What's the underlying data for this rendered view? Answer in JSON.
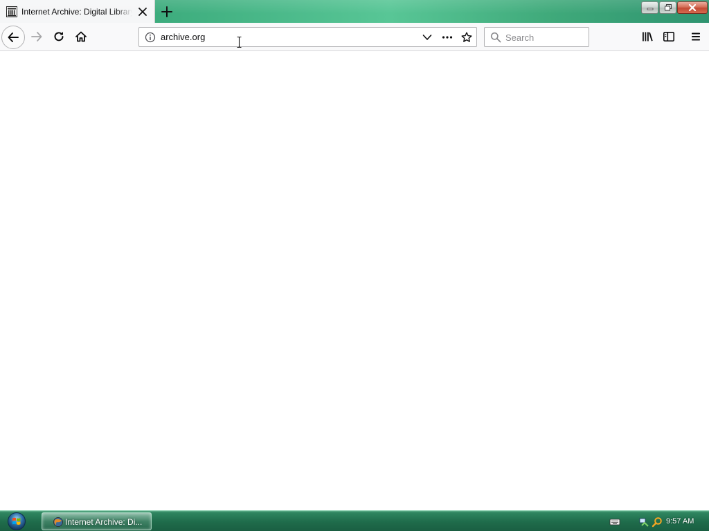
{
  "window": {
    "tab_title": "Internet Archive: Digital Library",
    "tab_favicon": "archive-building-icon"
  },
  "toolbar": {
    "url": "archive.org",
    "search_placeholder": "Search"
  },
  "taskbar": {
    "task_label": "Internet Archive: Di...",
    "clock": "9:57 AM"
  },
  "colors": {
    "accent": "#3fae7f",
    "taskbar": "#1f6c4b",
    "toolbar": "#f9f9fa"
  }
}
